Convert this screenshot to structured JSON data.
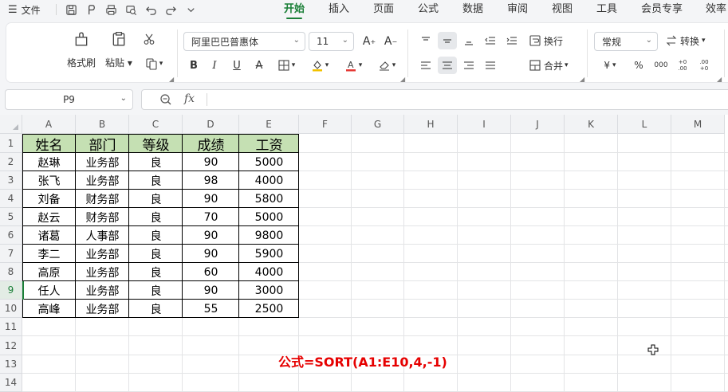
{
  "menubar": {
    "file_label": "文件",
    "tabs": [
      "开始",
      "插入",
      "页面",
      "公式",
      "数据",
      "审阅",
      "视图",
      "工具",
      "会员专享",
      "效率"
    ],
    "active_tab": "开始"
  },
  "ribbon": {
    "format_painter": "格式刷",
    "paste": "粘贴",
    "font_name": "阿里巴巴普惠体",
    "font_size": "11",
    "wrap": "换行",
    "merge": "合并",
    "number_format": "常规",
    "convert": "转换",
    "currency": "¥",
    "percent": "%",
    "thousands": "000",
    "inc_decimal": "+0 .00",
    "dec_decimal": ".00 +0"
  },
  "formula_bar": {
    "name_box": "P9",
    "fx": "fx",
    "content": ""
  },
  "sheet": {
    "columns": [
      "A",
      "B",
      "C",
      "D",
      "E",
      "F",
      "G",
      "H",
      "I",
      "J",
      "K",
      "L",
      "M"
    ],
    "rows": [
      "1",
      "2",
      "3",
      "4",
      "5",
      "6",
      "7",
      "8",
      "9",
      "10",
      "11",
      "12",
      "13",
      "14"
    ],
    "selected_row": "9",
    "table": {
      "headers": [
        "姓名",
        "部门",
        "等级",
        "成绩",
        "工资"
      ],
      "rows": [
        [
          "赵琳",
          "业务部",
          "良",
          "90",
          "5000"
        ],
        [
          "张飞",
          "业务部",
          "良",
          "98",
          "4000"
        ],
        [
          "刘备",
          "财务部",
          "良",
          "90",
          "5800"
        ],
        [
          "赵云",
          "财务部",
          "良",
          "70",
          "5000"
        ],
        [
          "诸葛",
          "人事部",
          "良",
          "90",
          "9800"
        ],
        [
          "李二",
          "业务部",
          "良",
          "90",
          "5900"
        ],
        [
          "高原",
          "业务部",
          "良",
          "60",
          "4000"
        ],
        [
          "任人",
          "业务部",
          "良",
          "90",
          "3000"
        ],
        [
          "高峰",
          "业务部",
          "良",
          "55",
          "2500"
        ]
      ]
    },
    "note": "公式=SORT(A1:E10,4,-1)"
  },
  "colors": {
    "accent": "#1a7f37",
    "header_fill": "#c5e0b3",
    "note": "#e60000"
  }
}
